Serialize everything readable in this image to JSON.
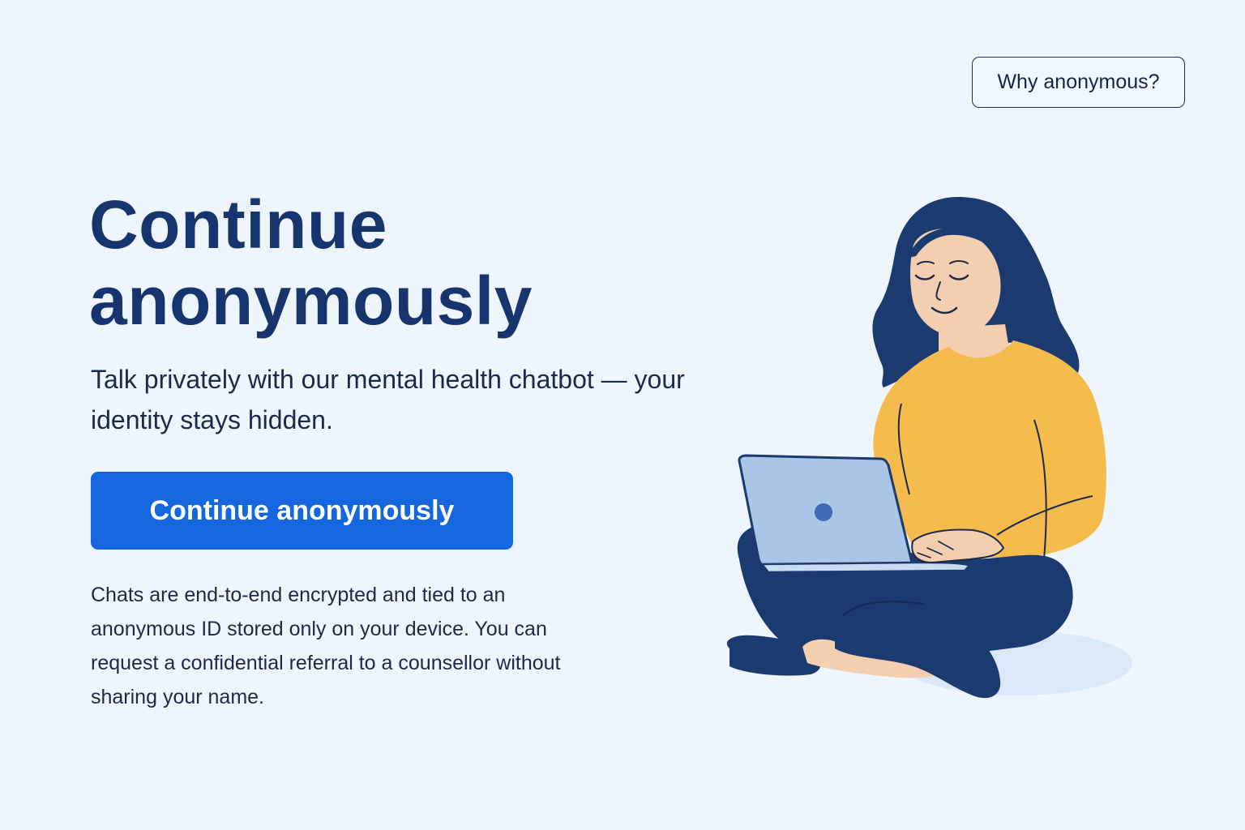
{
  "header": {
    "why_button_label": "Why anonymous?"
  },
  "hero": {
    "title": "Continue anonymously",
    "subtitle": "Talk privately with our mental health chatbot — your identity stays hidden.",
    "cta_label": "Continue anonymously",
    "privacy_note": "Chats are end-to-end encrypted and tied to an anonymous ID stored only on your device. You can request a confidential referral to a counsellor without sharing your name."
  },
  "illustration": {
    "icon": "person-with-laptop-illustration"
  },
  "colors": {
    "background": "#eef5fd",
    "title": "#16356e",
    "primary_button": "#1467df",
    "hair_and_pants": "#1b3a70",
    "sweater": "#f5bb4d",
    "laptop": "#a9c6e6"
  }
}
